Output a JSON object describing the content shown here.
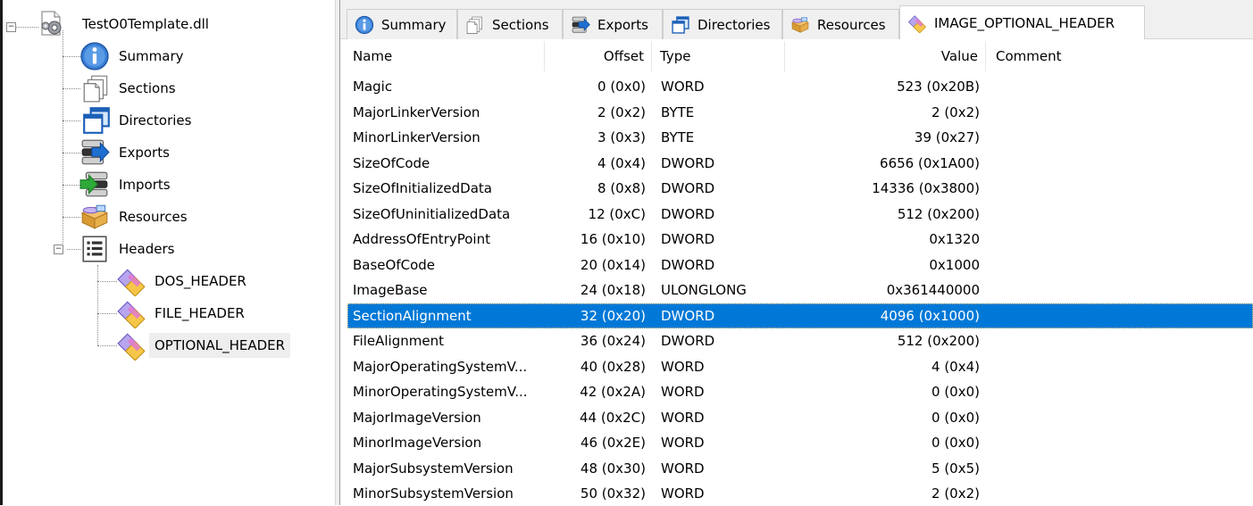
{
  "tree": {
    "root": {
      "label": "TestO0Template.dll",
      "icon": "dll-gear-icon"
    },
    "items": [
      {
        "label": "Summary",
        "icon": "info-icon"
      },
      {
        "label": "Sections",
        "icon": "pages-icon"
      },
      {
        "label": "Directories",
        "icon": "windows-icon"
      },
      {
        "label": "Exports",
        "icon": "exports-icon"
      },
      {
        "label": "Imports",
        "icon": "imports-icon"
      },
      {
        "label": "Resources",
        "icon": "resources-box-icon"
      },
      {
        "label": "Headers",
        "icon": "headers-list-icon"
      }
    ],
    "header_children": [
      {
        "label": "DOS_HEADER",
        "icon": "diamond-header-icon"
      },
      {
        "label": "FILE_HEADER",
        "icon": "diamond-header-icon"
      },
      {
        "label": "OPTIONAL_HEADER",
        "icon": "diamond-header-icon",
        "selected": true
      }
    ]
  },
  "tabs": [
    {
      "label": "Summary",
      "icon": "info-icon"
    },
    {
      "label": "Sections",
      "icon": "pages-icon"
    },
    {
      "label": "Exports",
      "icon": "exports-icon"
    },
    {
      "label": "Directories",
      "icon": "windows-icon"
    },
    {
      "label": "Resources",
      "icon": "resources-box-icon"
    },
    {
      "label": "IMAGE_OPTIONAL_HEADER",
      "icon": "diamond-header-icon",
      "active": true
    }
  ],
  "grid": {
    "columns": [
      "Name",
      "Offset",
      "Type",
      "Value",
      "Comment"
    ],
    "rows": [
      {
        "name": "Magic",
        "offset": "0 (0x0)",
        "type": "WORD",
        "value": "523 (0x20B)",
        "comment": ""
      },
      {
        "name": "MajorLinkerVersion",
        "offset": "2 (0x2)",
        "type": "BYTE",
        "value": "2 (0x2)",
        "comment": ""
      },
      {
        "name": "MinorLinkerVersion",
        "offset": "3 (0x3)",
        "type": "BYTE",
        "value": "39 (0x27)",
        "comment": ""
      },
      {
        "name": "SizeOfCode",
        "offset": "4 (0x4)",
        "type": "DWORD",
        "value": "6656 (0x1A00)",
        "comment": ""
      },
      {
        "name": "SizeOfInitializedData",
        "offset": "8 (0x8)",
        "type": "DWORD",
        "value": "14336 (0x3800)",
        "comment": ""
      },
      {
        "name": "SizeOfUninitializedData",
        "offset": "12 (0xC)",
        "type": "DWORD",
        "value": "512 (0x200)",
        "comment": ""
      },
      {
        "name": "AddressOfEntryPoint",
        "offset": "16 (0x10)",
        "type": "DWORD",
        "value": "0x1320",
        "comment": ""
      },
      {
        "name": "BaseOfCode",
        "offset": "20 (0x14)",
        "type": "DWORD",
        "value": "0x1000",
        "comment": ""
      },
      {
        "name": "ImageBase",
        "offset": "24 (0x18)",
        "type": "ULONGLONG",
        "value": "0x361440000",
        "comment": ""
      },
      {
        "name": "SectionAlignment",
        "offset": "32 (0x20)",
        "type": "DWORD",
        "value": "4096 (0x1000)",
        "comment": "",
        "selected": true
      },
      {
        "name": "FileAlignment",
        "offset": "36 (0x24)",
        "type": "DWORD",
        "value": "512 (0x200)",
        "comment": ""
      },
      {
        "name": "MajorOperatingSystemV...",
        "offset": "40 (0x28)",
        "type": "WORD",
        "value": "4 (0x4)",
        "comment": ""
      },
      {
        "name": "MinorOperatingSystemV...",
        "offset": "42 (0x2A)",
        "type": "WORD",
        "value": "0 (0x0)",
        "comment": ""
      },
      {
        "name": "MajorImageVersion",
        "offset": "44 (0x2C)",
        "type": "WORD",
        "value": "0 (0x0)",
        "comment": ""
      },
      {
        "name": "MinorImageVersion",
        "offset": "46 (0x2E)",
        "type": "WORD",
        "value": "0 (0x0)",
        "comment": ""
      },
      {
        "name": "MajorSubsystemVersion",
        "offset": "48 (0x30)",
        "type": "WORD",
        "value": "5 (0x5)",
        "comment": ""
      },
      {
        "name": "MinorSubsystemVersion",
        "offset": "50 (0x32)",
        "type": "WORD",
        "value": "2 (0x2)",
        "comment": ""
      }
    ]
  },
  "colors": {
    "selection": "#0078d7",
    "selection_text": "#ffffff",
    "tree_selected_bg": "#eeeeee"
  }
}
